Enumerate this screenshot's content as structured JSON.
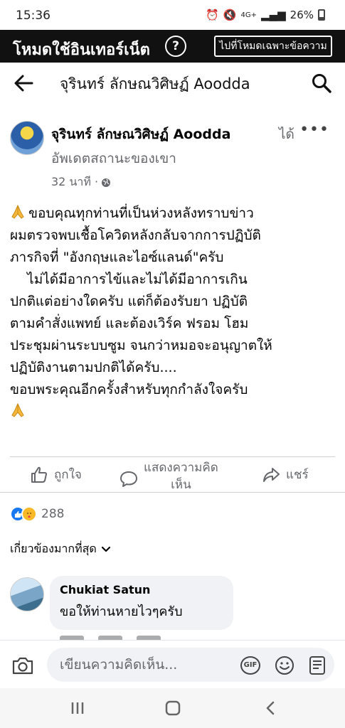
{
  "status_bar": {
    "time": "15:36",
    "network": "4G+",
    "battery": "26%"
  },
  "free_mode_bar": {
    "title": "โหมดใช้อินเทอร์เน็ต",
    "help": "?",
    "switch_button": "ไปที่โหมดเฉพาะข้อความ"
  },
  "header": {
    "title": "จุรินทร์ ลักษณวิศิษฏ์ Aoodda"
  },
  "post": {
    "author": "จุรินทร์ ลักษณวิศิษฏ์ Aoodda",
    "action_line1": "ได้",
    "action_line2": "อัพเดตสถานะของเขา",
    "time": "32 นาที ·",
    "body_lines": [
      "ขอบคุณทุกท่านที่เป็นห่วงหลังทราบข่าว",
      "ผมตรวจพบเชื้อโควิดหลังกลับจากการปฏิบัติ",
      "ภารกิจที่ \"อังกฤษและไอซ์แลนด์\"ครับ",
      "    ไม่ได้มีอาการไข้และไม่ได้มีอาการเกิน",
      "ปกติแต่อย่างใดครับ แต่ก็ต้องรับยา ปฏิบัติ",
      "ตามคำสั่งแพทย์ และต้องเวิร์ค ฟรอม โฮม",
      "ประชุมผ่านระบบซูม จนกว่าหมอจะอนุญาตให้",
      "ปฏิบัติงานตามปกติได้ครับ....",
      "ขอบพระคุณอีกครั้งสำหรับทุกกำลังใจครับ"
    ]
  },
  "actions": {
    "like": "ถูกใจ",
    "comment_line1": "แสดงความคิด",
    "comment_line2": "เห็น",
    "share": "แชร์"
  },
  "reactions": {
    "count": "288"
  },
  "comments_filter": {
    "label": "เกี่ยวข้องมากที่สุด"
  },
  "comments": [
    {
      "author": "Chukiat Satun",
      "text": "ขอให้ท่านหายไวๆครับ"
    }
  ],
  "composer": {
    "placeholder": "เขียนความคิดเห็น...",
    "gif": "GIF"
  },
  "colors": {
    "accent": "#1877f2",
    "secondary_text": "#65676b",
    "bubble": "#f0f2f5"
  }
}
